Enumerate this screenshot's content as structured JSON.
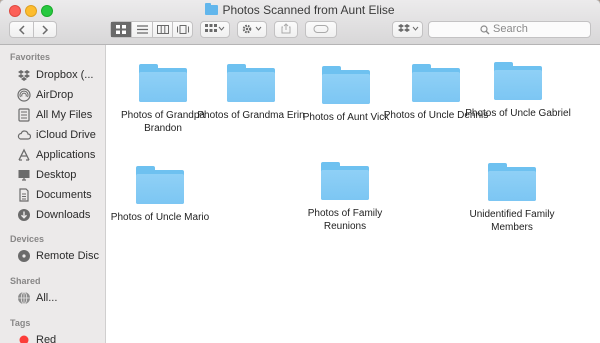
{
  "window": {
    "title": "Photos Scanned from Aunt Elise"
  },
  "toolbar": {
    "back_icon": "chevron-left-icon",
    "forward_icon": "chevron-right-icon",
    "search_placeholder": "Search"
  },
  "sidebar": {
    "favorites_heading": "Favorites",
    "favorites": [
      {
        "label": "Dropbox (...",
        "icon": "dropbox-icon"
      },
      {
        "label": "AirDrop",
        "icon": "airdrop-icon"
      },
      {
        "label": "All My Files",
        "icon": "all-files-icon"
      },
      {
        "label": "iCloud Drive",
        "icon": "cloud-icon"
      },
      {
        "label": "Applications",
        "icon": "applications-icon"
      },
      {
        "label": "Desktop",
        "icon": "desktop-icon"
      },
      {
        "label": "Documents",
        "icon": "documents-icon"
      },
      {
        "label": "Downloads",
        "icon": "downloads-icon"
      }
    ],
    "devices_heading": "Devices",
    "devices": [
      {
        "label": "Remote Disc",
        "icon": "disc-icon"
      }
    ],
    "shared_heading": "Shared",
    "shared": [
      {
        "label": "All...",
        "icon": "network-icon"
      }
    ],
    "tags_heading": "Tags",
    "tags": [
      {
        "label": "Red",
        "color": "#fc3d39"
      }
    ]
  },
  "folders": [
    {
      "name": "Photos of Grandpa Brandon"
    },
    {
      "name": "Photos of Grandma Erin"
    },
    {
      "name": "Photos of Aunt Vick"
    },
    {
      "name": "Photos of Uncle Dennis"
    },
    {
      "name": "Photos of Uncle Gabriel"
    },
    {
      "name": "Photos of Uncle Mario"
    },
    {
      "name": "Photos of Family Reunions"
    },
    {
      "name": "Unidentified Family Members"
    }
  ],
  "colors": {
    "folder": "#6ec1f0",
    "sidebar_bg": "#eceaea",
    "toolbar_bg": "#d8d7d8"
  }
}
